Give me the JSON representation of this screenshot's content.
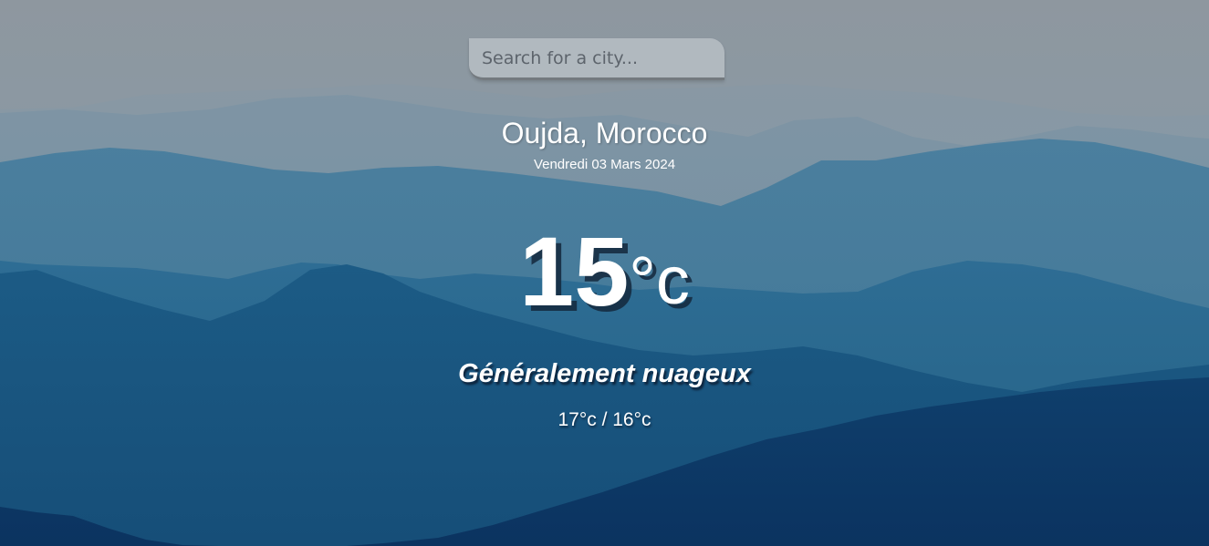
{
  "search": {
    "placeholder": "Search for a city...",
    "value": ""
  },
  "location": {
    "city": "Oujda, Morocco",
    "date": "Vendredi 03 Mars 2024"
  },
  "weather": {
    "temperature": "15",
    "unit": "°c",
    "condition": "Généralement nuageux",
    "hi_low": "17°c / 16°c"
  },
  "background": {
    "description_colors": [
      "#8e9aa4",
      "#6f8ea3",
      "#3f7896",
      "#1f5f86",
      "#0f3d66"
    ],
    "icon": "mountain-landscape"
  }
}
